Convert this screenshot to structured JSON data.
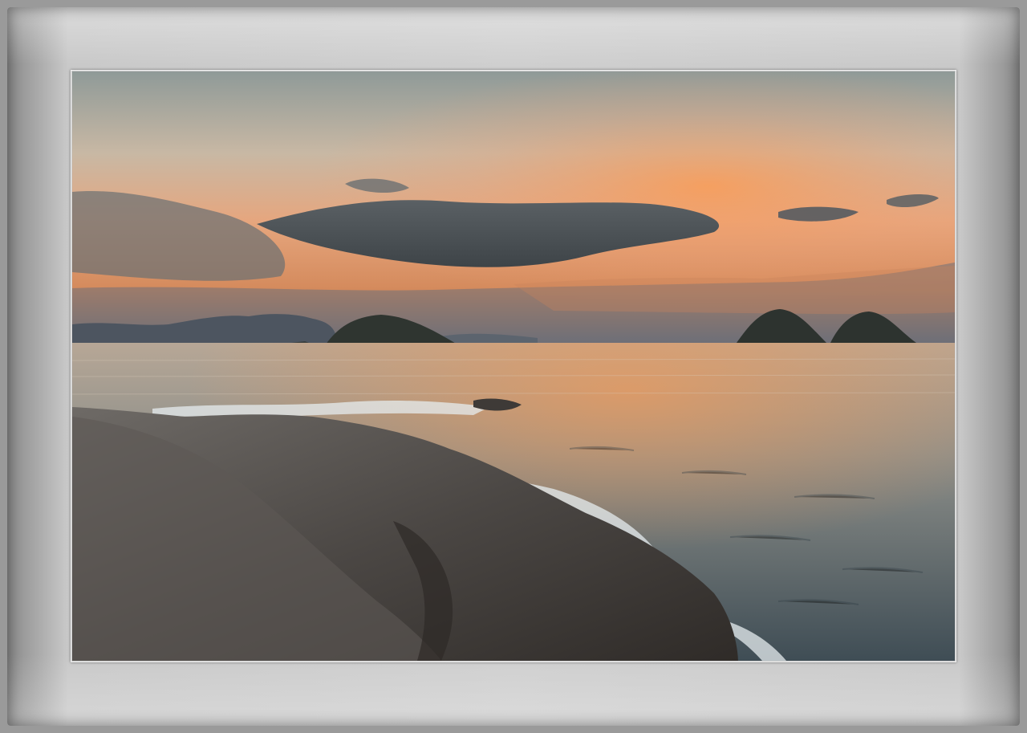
{
  "image": {
    "subject": "sunset-over-sea-with-islands",
    "colors": {
      "frame": "#9a9a9a",
      "mat": "#cfcfcf",
      "sky_top": "#8f9a96",
      "sky_glow": "#f4a46a",
      "cloud": "#4e5458",
      "sea": "#7c8a8c",
      "rock": "#4a4642"
    }
  }
}
